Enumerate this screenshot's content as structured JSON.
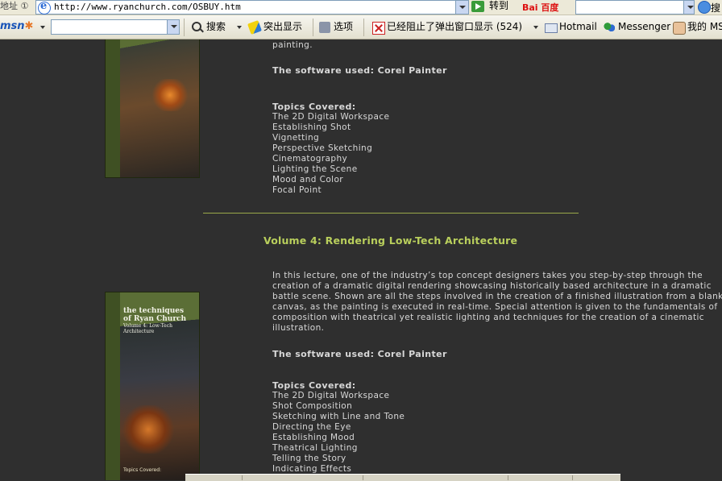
{
  "address_bar": {
    "label": "地址 ①",
    "url": "http://www.ryanchurch.com/OSBUY.htm",
    "go_label": "转到",
    "baidu_logo": "Bai 百度",
    "right_label": "搜"
  },
  "toolbar": {
    "msn_logo": "msn",
    "search_btn": "搜索",
    "highlight_btn": "突出显示",
    "options_btn": "选项",
    "popup_blocker": "已经阻止了弹出窗口显示 (524)",
    "hotmail": "Hotmail",
    "messenger": "Messenger",
    "my_msn": "我的 MS"
  },
  "volume3": {
    "para_tail": "painting.",
    "software": "The software used: Corel Painter",
    "topics_heading": "Topics Covered:",
    "topics": [
      "The 2D Digital Workspace",
      "Establishing Shot",
      "Vignetting",
      "Perspective Sketching",
      "Cinematography",
      "Lighting the Scene",
      "Mood and Color",
      "Focal Point"
    ]
  },
  "volume4": {
    "title": "Volume 4: Rendering Low-Tech Architecture",
    "paragraph": "In this lecture, one of the industry’s top concept designers takes you step-by-step through the creation of a dramatic digital rendering showcasing historically based architecture in a dramatic battle scene. Shown are all the steps involved in the creation of a finished illustration from a blank canvas, as the painting is executed in real-time. Special attention is given to the fundamentals of composition with theatrical yet realistic lighting and techniques for the creation of a cinematic illustration.",
    "software": "The software used: Corel Painter",
    "topics_heading": "Topics Covered:",
    "topics": [
      "The 2D Digital Workspace",
      "Shot Composition",
      "Sketching with Line and Tone",
      "Directing the Eye",
      "Establishing Mood",
      "Theatrical Lighting",
      "Telling the Story",
      "Indicating Effects"
    ]
  },
  "dvd_box": {
    "title": "the techniques of Ryan Church",
    "subtitle": "Volume 4: Low-Tech Architecture",
    "cover_topics_heading": "Topics Covered:"
  },
  "colors": {
    "background": "#2f2f2f",
    "body_text": "#d8d8d8",
    "title_accent": "#b9cf5c",
    "divider": "#9aa84a"
  }
}
